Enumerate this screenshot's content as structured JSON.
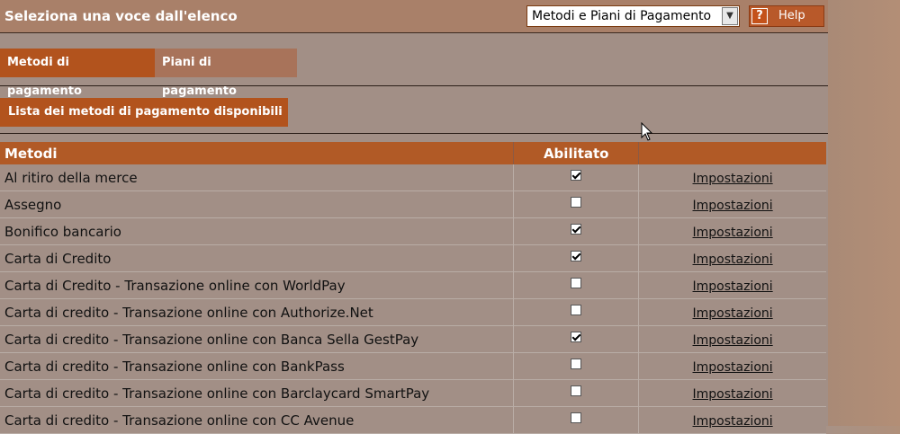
{
  "header": {
    "title": "Seleziona una voce dall'elenco",
    "select_value": "Metodi e Piani di Pagamento",
    "help_label": "Help",
    "help_glyph": "?"
  },
  "tabs": [
    {
      "label": "Metodi di pagamento",
      "active": true
    },
    {
      "label": "Piani di pagamento",
      "active": false
    }
  ],
  "list_button": "Lista dei metodi di pagamento disponibili",
  "table": {
    "columns": [
      "Metodi",
      "Abilitato",
      ""
    ],
    "rows": [
      {
        "name": "Al ritiro della merce",
        "enabled": true,
        "action": "Impostazioni"
      },
      {
        "name": "Assegno",
        "enabled": false,
        "action": "Impostazioni"
      },
      {
        "name": "Bonifico bancario",
        "enabled": true,
        "action": "Impostazioni"
      },
      {
        "name": "Carta di Credito",
        "enabled": true,
        "action": "Impostazioni"
      },
      {
        "name": "Carta di Credito - Transazione online con WorldPay",
        "enabled": false,
        "action": "Impostazioni"
      },
      {
        "name": "Carta di credito - Transazione online con Authorize.Net",
        "enabled": false,
        "action": "Impostazioni"
      },
      {
        "name": "Carta di credito - Transazione online con Banca Sella GestPay",
        "enabled": true,
        "action": "Impostazioni"
      },
      {
        "name": "Carta di credito - Transazione online con BankPass",
        "enabled": false,
        "action": "Impostazioni"
      },
      {
        "name": "Carta di credito - Transazione online con Barclaycard SmartPay",
        "enabled": false,
        "action": "Impostazioni"
      },
      {
        "name": "Carta di credito - Transazione online con CC Avenue",
        "enabled": false,
        "action": "Impostazioni"
      }
    ]
  },
  "colors": {
    "accent": "#b2531d",
    "background": "#a28f86",
    "header_bar": "#a98069"
  },
  "icons": {
    "cursor": "mouse-pointer-icon",
    "dropdown": "chevron-down-icon",
    "help": "help-icon"
  }
}
